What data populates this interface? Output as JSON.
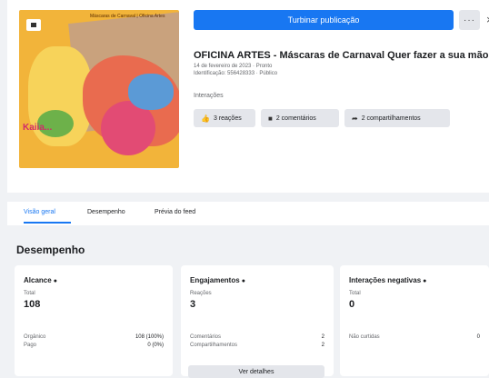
{
  "thumbnail": {
    "title_text": "Máscaras de Carnaval | Oficina Artes",
    "brand_text": "Kaiia..."
  },
  "actions": {
    "boost_label": "Turbinar publicação",
    "more_label": "···",
    "close_label": "×"
  },
  "post": {
    "title": "OFICINA ARTES - Máscaras de Carnaval Quer fazer a sua mão...",
    "meta_line1": "14 de fevereiro de 2023 · Pronto",
    "meta_line2": "Identificação: 556428333 · Público",
    "interactions_label": "Interações",
    "chips": [
      {
        "icon": "like-icon",
        "glyph": "👍",
        "label": "3 reações"
      },
      {
        "icon": "comment-icon",
        "glyph": "■",
        "label": "2 comentários"
      },
      {
        "icon": "share-icon",
        "glyph": "➦",
        "label": "2 compartilhamentos"
      }
    ]
  },
  "tabs": [
    {
      "label": "Visão geral",
      "active": true
    },
    {
      "label": "Desempenho",
      "active": false
    },
    {
      "label": "Prévia do feed",
      "active": false
    }
  ],
  "section_title": "Desempenho",
  "cards": [
    {
      "title": "Alcance",
      "sub": "Total",
      "value": "108",
      "rows": [
        {
          "label": "Orgânico",
          "value": "108 (100%)"
        },
        {
          "label": "Pago",
          "value": "0 (0%)"
        }
      ]
    },
    {
      "title": "Engajamentos",
      "sub": "Reações",
      "value": "3",
      "rows": [
        {
          "label": "Comentários",
          "value": "2"
        },
        {
          "label": "Compartilhamentos",
          "value": "2"
        }
      ],
      "button_label": "Ver detalhes"
    },
    {
      "title": "Interações negativas",
      "sub": "Total",
      "value": "0",
      "rows": [
        {
          "label": "Não curtidas",
          "value": "0"
        }
      ]
    }
  ],
  "colors": {
    "accent": "#1877f2",
    "background": "#f0f2f5",
    "card": "#ffffff"
  }
}
